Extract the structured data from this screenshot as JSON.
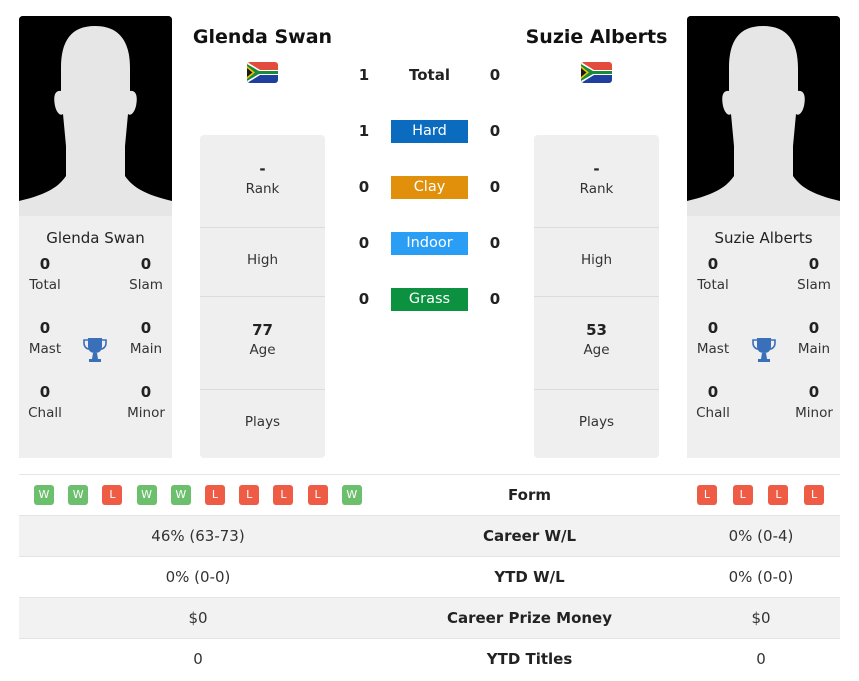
{
  "player1": {
    "name": "Glenda Swan",
    "country_flag": "south-africa-flag",
    "titles": {
      "total": {
        "label": "Total",
        "value": "0"
      },
      "slam": {
        "label": "Slam",
        "value": "0"
      },
      "mast": {
        "label": "Mast",
        "value": "0"
      },
      "main": {
        "label": "Main",
        "value": "0"
      },
      "chall": {
        "label": "Chall",
        "value": "0"
      },
      "minor": {
        "label": "Minor",
        "value": "0"
      }
    },
    "stats": {
      "rank": {
        "label": "Rank",
        "value": "-"
      },
      "high": {
        "label": "High",
        "value": ""
      },
      "age": {
        "label": "Age",
        "value": "77"
      },
      "plays": {
        "label": "Plays",
        "value": ""
      }
    },
    "form": [
      "W",
      "W",
      "L",
      "W",
      "W",
      "L",
      "L",
      "L",
      "L",
      "W"
    ]
  },
  "player2": {
    "name": "Suzie Alberts",
    "country_flag": "south-africa-flag",
    "titles": {
      "total": {
        "label": "Total",
        "value": "0"
      },
      "slam": {
        "label": "Slam",
        "value": "0"
      },
      "mast": {
        "label": "Mast",
        "value": "0"
      },
      "main": {
        "label": "Main",
        "value": "0"
      },
      "chall": {
        "label": "Chall",
        "value": "0"
      },
      "minor": {
        "label": "Minor",
        "value": "0"
      }
    },
    "stats": {
      "rank": {
        "label": "Rank",
        "value": "-"
      },
      "high": {
        "label": "High",
        "value": ""
      },
      "age": {
        "label": "Age",
        "value": "53"
      },
      "plays": {
        "label": "Plays",
        "value": ""
      }
    },
    "form": [
      "L",
      "L",
      "L",
      "L"
    ]
  },
  "h2h": {
    "total": {
      "label": "Total",
      "p1": "1",
      "p2": "0"
    },
    "surfaces": [
      {
        "label": "Hard",
        "p1": "1",
        "p2": "0",
        "color": "#0b6bbf"
      },
      {
        "label": "Clay",
        "p1": "0",
        "p2": "0",
        "color": "#e0900a"
      },
      {
        "label": "Indoor",
        "p1": "0",
        "p2": "0",
        "color": "#2a9df4"
      },
      {
        "label": "Grass",
        "p1": "0",
        "p2": "0",
        "color": "#0b9140"
      }
    ]
  },
  "comparison": {
    "form_label": "Form",
    "rows": [
      {
        "label": "Career W/L",
        "p1": "46% (63-73)",
        "p2": "0% (0-4)"
      },
      {
        "label": "YTD W/L",
        "p1": "0% (0-0)",
        "p2": "0% (0-0)"
      },
      {
        "label": "Career Prize Money",
        "p1": "$0",
        "p2": "$0"
      },
      {
        "label": "YTD Titles",
        "p1": "0",
        "p2": "0"
      }
    ]
  },
  "colors": {
    "win": "#6cbf6c",
    "loss": "#ee5c45",
    "trophy": "#3a6fba"
  }
}
